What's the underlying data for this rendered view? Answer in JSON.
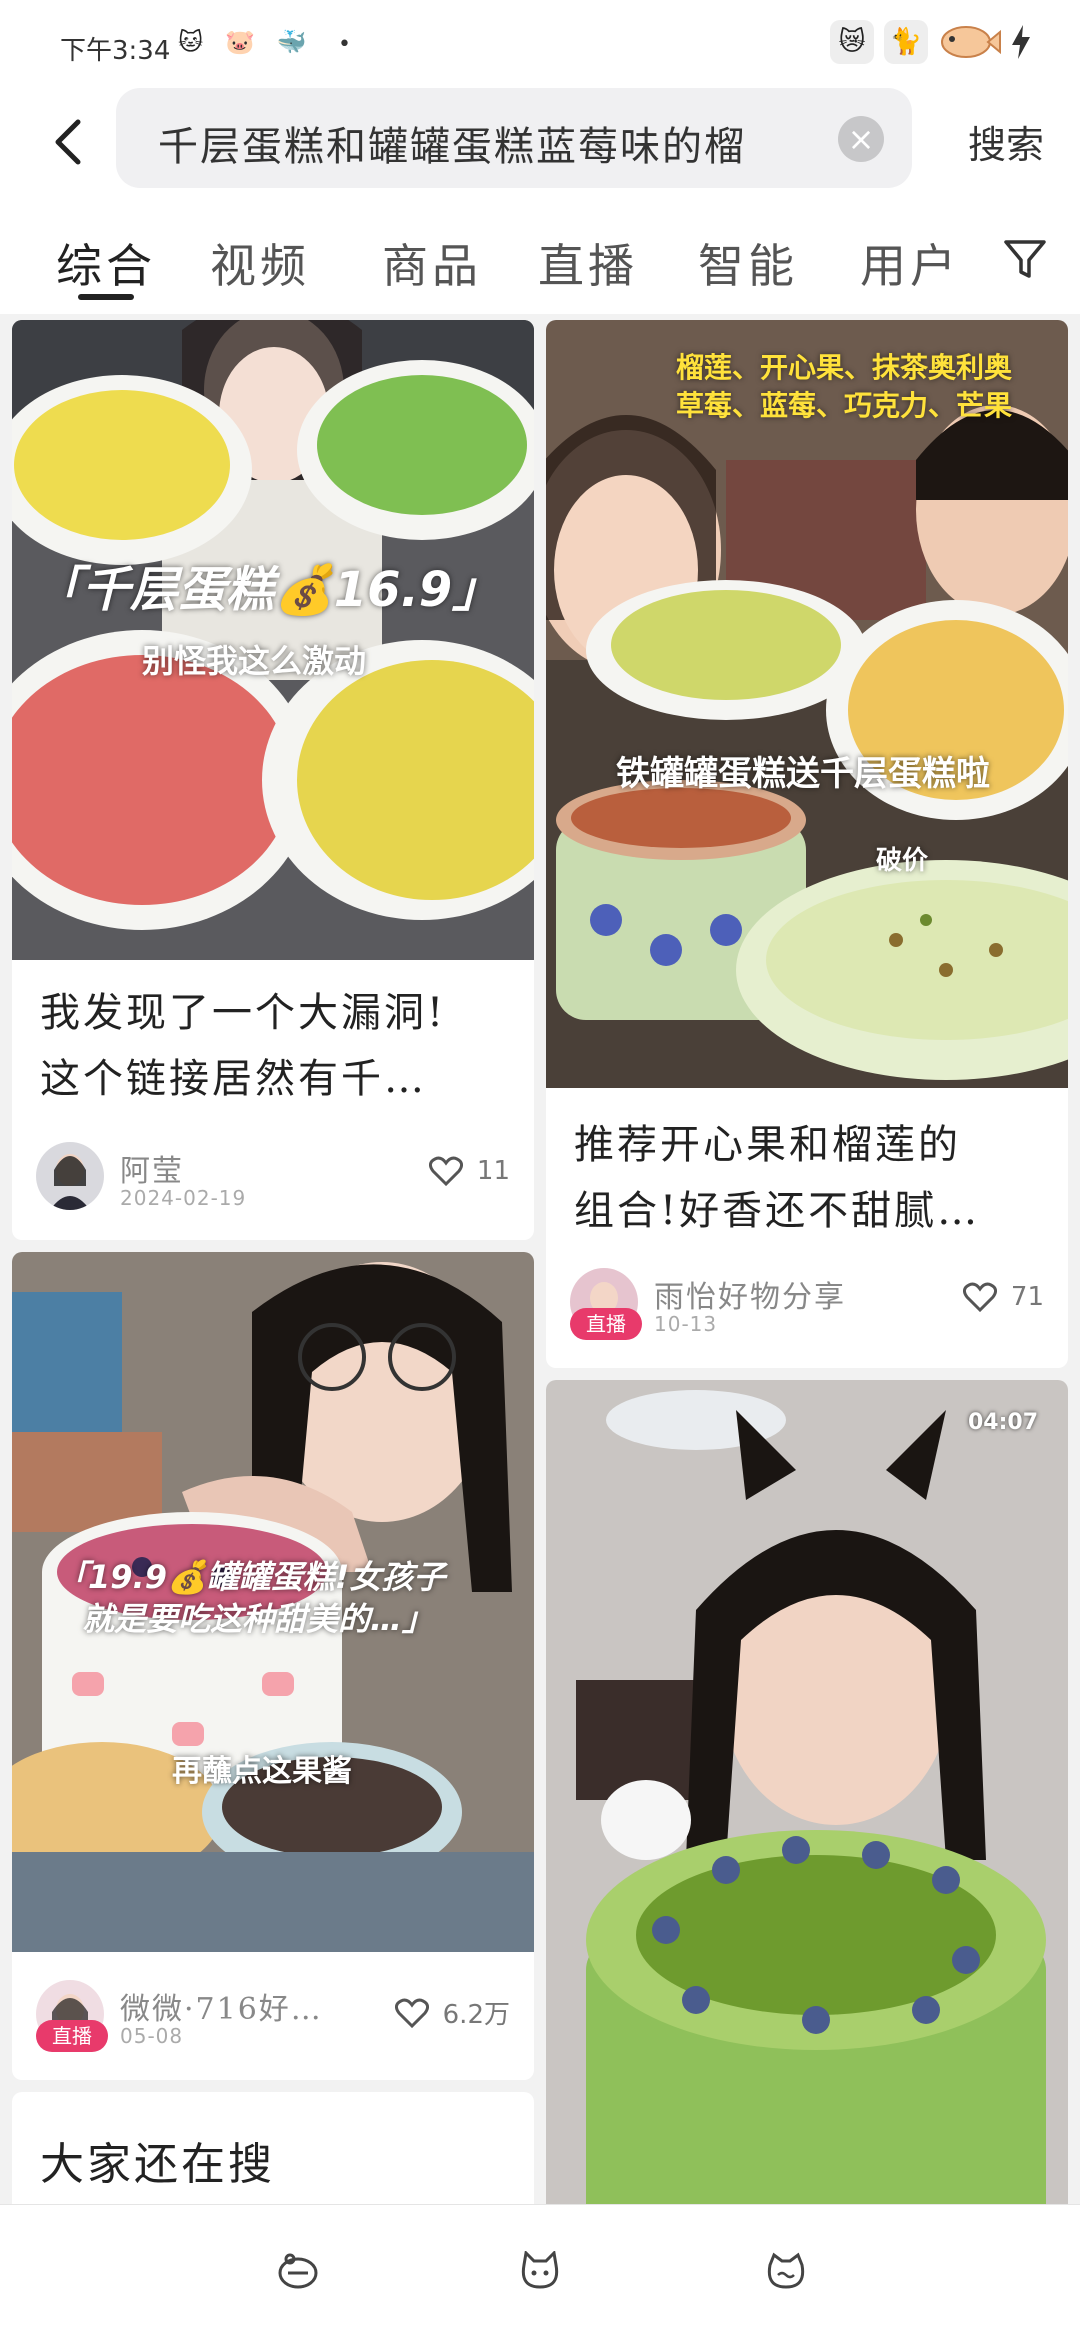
{
  "status_bar": {
    "time": "下午3:34",
    "dot": "•"
  },
  "search": {
    "query": "千层蛋糕和罐罐蛋糕蓝莓味的榴",
    "clear_symbol": "×",
    "submit_label": "搜索"
  },
  "tabs": [
    {
      "label": "综合",
      "active": true
    },
    {
      "label": "视频"
    },
    {
      "label": "商品"
    },
    {
      "label": "直播"
    },
    {
      "label": "智能"
    },
    {
      "label": "用户"
    }
  ],
  "posts": [
    {
      "overlay_main": "「千层蛋糕💰16.9」",
      "overlay_sub": "别怪我这么激动",
      "title_line1": "我发现了一个大漏洞!",
      "title_line2": "这个链接居然有千…",
      "author": "阿莹",
      "date": "2024-02-19",
      "likes": "11"
    },
    {
      "overlay_top1": "榴莲、开心果、抹茶奥利奥",
      "overlay_top2": "草莓、蓝莓、巧克力、芒果",
      "overlay_mid": "铁罐罐蛋糕送千层蛋糕啦",
      "overlay_small": "破价",
      "title_line1": "推荐开心果和榴莲的",
      "title_line2": "组合!好香还不甜腻…",
      "author": "雨怡好物分享",
      "date": "10-13",
      "likes": "71",
      "live_label": "直播"
    },
    {
      "overlay_line1": "「19.9💰罐罐蛋糕!女孩子",
      "overlay_line2": "就是要吃这种甜美的…」",
      "overlay_sub": "再蘸点这果酱",
      "author": "微微·716好…",
      "date": "05-08",
      "likes": "6.2万",
      "live_label": "直播"
    },
    {
      "duration": "04:07"
    }
  ],
  "related_search": {
    "title": "大家还在搜"
  },
  "colors": {
    "accent": "#e83a6b",
    "background": "#f2f2f2"
  }
}
